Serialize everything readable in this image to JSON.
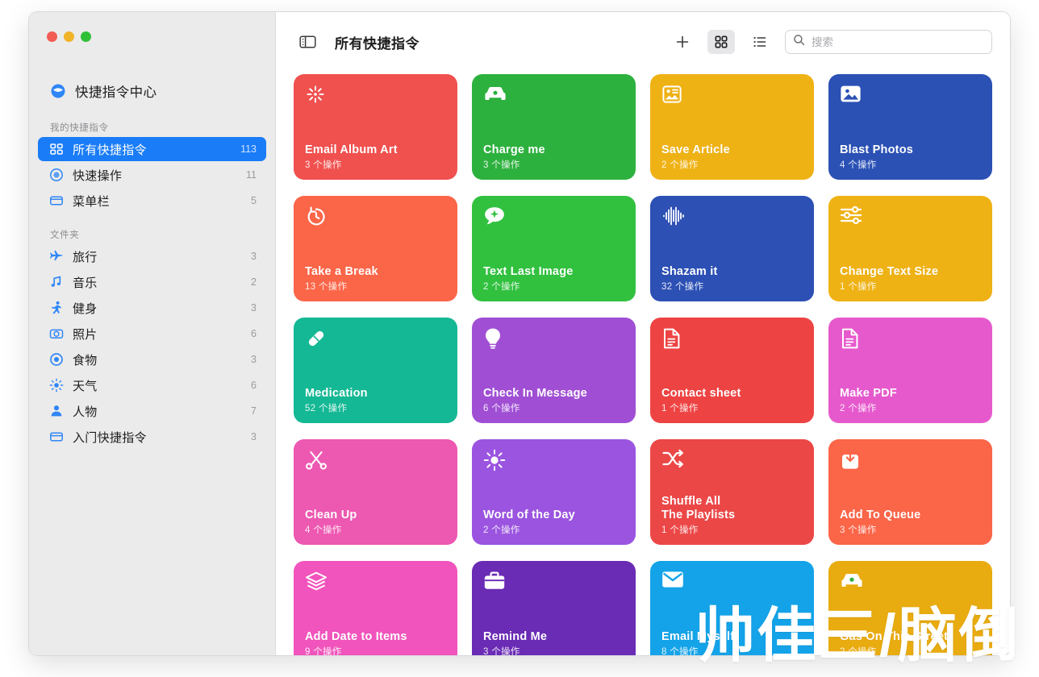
{
  "window": {
    "traffic_lights": {
      "close": "close-button",
      "minimize": "minimize-button",
      "maximize": "maximize-button",
      "close_color": "#f25c54",
      "minimize_color": "#f0b429",
      "maximize_color": "#2ec037"
    }
  },
  "sidebar": {
    "shortcuts_center": {
      "label": "快捷指令中心",
      "icon": "shortcuts-center-icon"
    },
    "groups": [
      {
        "title": "我的快捷指令",
        "items": [
          {
            "label": "所有快捷指令",
            "count": "113",
            "icon": "grid-icon",
            "selected": true
          },
          {
            "label": "快速操作",
            "count": "11",
            "icon": "quick-action-icon",
            "selected": false
          },
          {
            "label": "菜单栏",
            "count": "5",
            "icon": "menubar-icon",
            "selected": false
          }
        ]
      },
      {
        "title": "文件夹",
        "items": [
          {
            "label": "旅行",
            "count": "3",
            "icon": "airplane-icon",
            "selected": false
          },
          {
            "label": "音乐",
            "count": "2",
            "icon": "music-note-icon",
            "selected": false
          },
          {
            "label": "健身",
            "count": "3",
            "icon": "running-person-icon",
            "selected": false
          },
          {
            "label": "照片",
            "count": "6",
            "icon": "camera-icon",
            "selected": false
          },
          {
            "label": "食物",
            "count": "3",
            "icon": "circle-icon",
            "selected": false
          },
          {
            "label": "天气",
            "count": "6",
            "icon": "sun-icon",
            "selected": false
          },
          {
            "label": "人物",
            "count": "7",
            "icon": "person-icon",
            "selected": false
          },
          {
            "label": "入门快捷指令",
            "count": "3",
            "icon": "folder-icon",
            "selected": false
          }
        ]
      }
    ],
    "accent_color": "#1a7cf7"
  },
  "toolbar": {
    "sidebar_toggle": "sidebar-toggle-icon",
    "title": "所有快捷指令",
    "add_label": "+",
    "grid_view": "grid-view-icon",
    "list_view": "list-view-icon",
    "search": {
      "placeholder": "搜索",
      "value": ""
    }
  },
  "grid": {
    "cards": [
      {
        "title": "Email Album Art",
        "subtitle": "3 个操作",
        "color": "#f0514f",
        "icon": "sparkle-wand-icon"
      },
      {
        "title": "Charge me",
        "subtitle": "3 个操作",
        "color": "#2db13e",
        "icon": "car-icon"
      },
      {
        "title": "Save Article",
        "subtitle": "2 个操作",
        "color": "#efb215",
        "icon": "article-icon"
      },
      {
        "title": "Blast Photos",
        "subtitle": "4 个操作",
        "color": "#2b51b5",
        "icon": "photo-icon"
      },
      {
        "title": "Take a Break",
        "subtitle": "13 个操作",
        "color": "#fb6548",
        "icon": "timer-icon"
      },
      {
        "title": "Text Last Image",
        "subtitle": "2 个操作",
        "color": "#31c13f",
        "icon": "message-sparkle-icon"
      },
      {
        "title": "Shazam it",
        "subtitle": "32 个操作",
        "color": "#2c50b4",
        "icon": "waveform-icon"
      },
      {
        "title": "Change Text Size",
        "subtitle": "1 个操作",
        "color": "#efb215",
        "icon": "sliders-icon"
      },
      {
        "title": "Medication",
        "subtitle": "52 个操作",
        "color": "#14b894",
        "icon": "pill-icon"
      },
      {
        "title": "Check In Message",
        "subtitle": "6 个操作",
        "color": "#a04fd4",
        "icon": "lightbulb-icon"
      },
      {
        "title": "Contact sheet",
        "subtitle": "1 个操作",
        "color": "#ee4343",
        "icon": "document-icon"
      },
      {
        "title": "Make PDF",
        "subtitle": "2 个操作",
        "color": "#e659cd",
        "icon": "document-icon"
      },
      {
        "title": "Clean Up",
        "subtitle": "4 个操作",
        "color": "#ed58b1",
        "icon": "scissors-icon"
      },
      {
        "title": "Word of the Day",
        "subtitle": "2 个操作",
        "color": "#9b54e0",
        "icon": "sun-bright-icon"
      },
      {
        "title": "Shuffle All\nThe Playlists",
        "subtitle": "1 个操作",
        "color": "#ec4747",
        "icon": "shuffle-icon"
      },
      {
        "title": "Add To Queue",
        "subtitle": "3 个操作",
        "color": "#fb6548",
        "icon": "add-queue-icon"
      },
      {
        "title": "Add Date to Items",
        "subtitle": "9 个操作",
        "color": "#f154bc",
        "icon": "layers-icon"
      },
      {
        "title": "Remind Me",
        "subtitle": "3 个操作",
        "color": "#6a2bb5",
        "icon": "briefcase-icon"
      },
      {
        "title": "Email Myself",
        "subtitle": "8 个操作",
        "color": "#14a3e8",
        "icon": "envelope-icon"
      },
      {
        "title": "Gas On This Street",
        "subtitle": "2 个操作",
        "color": "#e8ab10",
        "icon": "car-icon"
      }
    ]
  },
  "watermark": {
    "text": "帅佳三/脑倒"
  }
}
